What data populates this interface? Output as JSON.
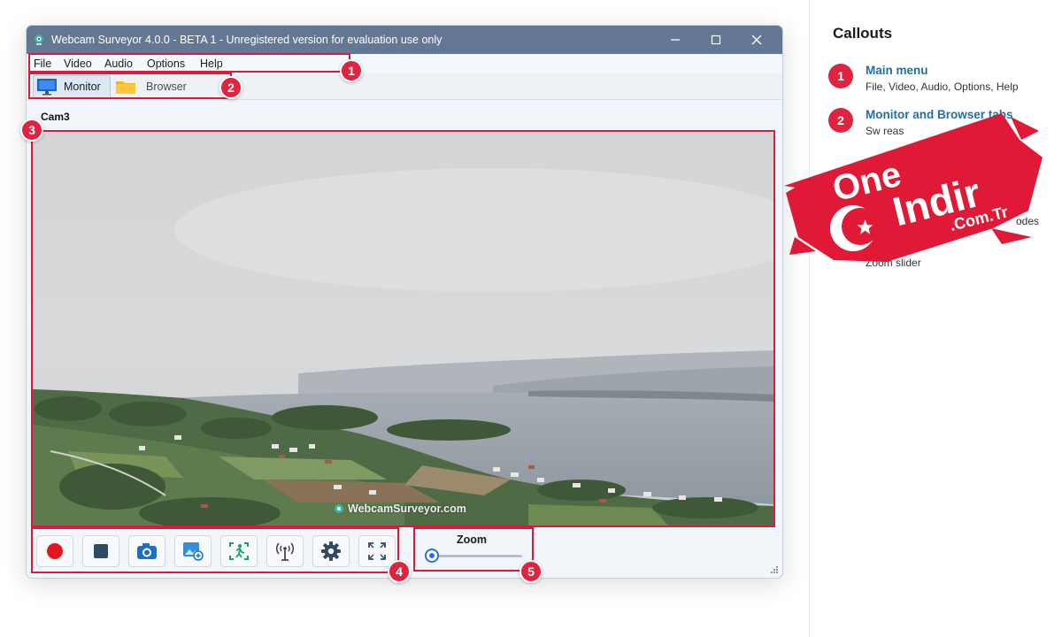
{
  "window": {
    "title": "Webcam Surveyor 4.0.0 - BETA 1  - Unregistered version for evaluation use only",
    "controls": [
      "minimize",
      "maximize",
      "close"
    ]
  },
  "menu": {
    "items": [
      "File",
      "Video",
      "Audio",
      "Options",
      "Help"
    ]
  },
  "tabs": [
    {
      "label": "Monitor",
      "icon": "monitor-icon",
      "active": true
    },
    {
      "label": "Browser",
      "icon": "folder-icon",
      "active": false
    }
  ],
  "camera": {
    "name": "Cam3",
    "watermark": "WebcamSurveyor.com"
  },
  "toolbar": {
    "buttons": [
      {
        "icon": "record-icon"
      },
      {
        "icon": "stop-icon"
      },
      {
        "icon": "camera-snapshot-icon"
      },
      {
        "icon": "image-capture-icon"
      },
      {
        "icon": "motion-detection-icon"
      },
      {
        "icon": "broadcast-icon"
      },
      {
        "icon": "settings-gear-icon"
      },
      {
        "icon": "fullscreen-icon"
      }
    ]
  },
  "zoom": {
    "label": "Zoom",
    "value": 0
  },
  "callout_badges": [
    "1",
    "2",
    "3",
    "4",
    "5"
  ],
  "panel": {
    "title": "Callouts",
    "items": [
      {
        "number": "1",
        "title": "Main menu",
        "desc": "File, Video, Audio, Options, Help"
      },
      {
        "number": "2",
        "title": "Monitor and Browser tabs",
        "desc": "Sw            reas"
      },
      {
        "number": "",
        "title": "",
        "desc": "odes"
      },
      {
        "number": "",
        "title": "Zo",
        "desc": "Zoom slider"
      }
    ]
  },
  "stamp": {
    "line1": "One",
    "line2": "Indir",
    "line3": ".Com.Tr"
  },
  "colors": {
    "titlebar": "#647795",
    "accent_red": "#e0243f",
    "callout_link": "#1f6fa8",
    "slider": "#2f6fd6"
  }
}
